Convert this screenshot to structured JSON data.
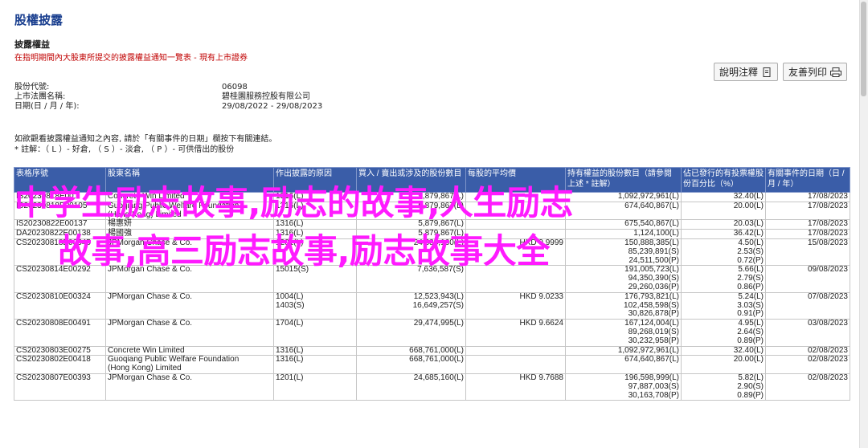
{
  "page": {
    "title": "股權披露"
  },
  "section": {
    "title": "披露權益",
    "subtitle": "在指明期間內大股東所提交的披露權益通知一覽表 - 現有上市證券"
  },
  "toolbar": {
    "explain_label": "說明注釋",
    "print_label": "友善列印"
  },
  "info": {
    "stock_code_label": "股份代號:",
    "stock_code": "06098",
    "company_label": "上市法團名稱:",
    "company": "碧桂園服務控股有限公司",
    "date_label": "日期(日 / 月 / 年):",
    "date_range": "29/08/2022 - 29/08/2023"
  },
  "note": {
    "line1": "如欲觀看披露權益通知之內容, 請於「有關事件的日期」欄按下有關連結。",
    "line2": "* 註解：（ L ）- 好倉, （ S ）- 淡倉, （ P ）- 可供借出的股份"
  },
  "table": {
    "headers": [
      "表格序號",
      "股東名稱",
      "作出披露的原因",
      "買入 / 賣出或涉及的股份數目",
      "每股的平均價",
      "持有權益的股份數目（請參閱上述 * 註解）",
      "佔已發行的有投票權股份百分比（%）",
      "有關事件的日期（日 / 月 / 年）"
    ],
    "rows": [
      {
        "form": "IS20230818E00...",
        "name": "Concrete Win Limited",
        "reason": "1316(L)",
        "shares": "5,879,867(L)",
        "price": "",
        "holding": "1,092,972,961(L)",
        "pct": "32.40(L)",
        "date": "17/08/2023"
      },
      {
        "form": "IS20230818E00105",
        "name": "Guoqiang Public Welfare Foundation\n(Hong Kong) Limited",
        "reason": "1316(L)",
        "shares": "5,879,867(L)",
        "price": "",
        "holding": "674,640,867(L)",
        "pct": "20.00(L)",
        "date": "17/08/2023"
      },
      {
        "form": "IS20230822E00137",
        "name": "楊惠妍",
        "reason": "1316(L)",
        "shares": "5,879,867(L)",
        "price": "",
        "holding": "675,540,867(L)",
        "pct": "20.03(L)",
        "date": "17/08/2023"
      },
      {
        "form": "DA20230822E00138",
        "name": "楊國強",
        "reason": "1316(L)",
        "shares": "5,879,867(L)",
        "price": "",
        "holding": "1,124,100(L)",
        "pct": "36.42(L)",
        "date": "17/08/2023"
      },
      {
        "form": "CS20230818E00545",
        "name": "JPMorgan Chase & Co.",
        "reason": "1201(L)",
        "shares": "24,685,160(L)",
        "price": "HKD 9.9999",
        "holding": "150,888,385(L)\n85,239,891(S)\n24,511,500(P)",
        "pct": "4.50(L)\n2.53(S)\n0.72(P)",
        "date": "15/08/2023"
      },
      {
        "form": "CS20230814E00292",
        "name": "JPMorgan Chase & Co.",
        "reason": "15015(S)",
        "shares": "7,636,587(S)",
        "price": "",
        "holding": "191,005,723(L)\n94,350,390(S)\n29,260,036(P)",
        "pct": "5.66(L)\n2.79(S)\n0.86(P)",
        "date": "09/08/2023"
      },
      {
        "form": "CS20230810E00324",
        "name": "JPMorgan Chase & Co.",
        "reason": "1004(L)\n1403(S)",
        "shares": "12,523,943(L)\n16,649,257(S)",
        "price": "HKD 9.0233",
        "holding": "176,793,821(L)\n102,458,598(S)\n30,826,878(P)",
        "pct": "5.24(L)\n3.03(S)\n0.91(P)",
        "date": "07/08/2023"
      },
      {
        "form": "CS20230808E00491",
        "name": "JPMorgan Chase & Co.",
        "reason": "1704(L)",
        "shares": "29,474,995(L)",
        "price": "HKD 9.6624",
        "holding": "167,124,004(L)\n89,268,019(S)\n30,232,958(P)",
        "pct": "4.95(L)\n2.64(S)\n0.89(P)",
        "date": "03/08/2023"
      },
      {
        "form": "CS20230803E00275",
        "name": "Concrete Win Limited",
        "reason": "1316(L)",
        "shares": "668,761,000(L)",
        "price": "",
        "holding": "1,092,972,961(L)",
        "pct": "32.40(L)",
        "date": "02/08/2023"
      },
      {
        "form": "CS20230802E00418",
        "name": "Guoqiang Public Welfare Foundation\n(Hong Kong) Limited",
        "reason": "1316(L)",
        "shares": "668,761,000(L)",
        "price": "",
        "holding": "674,640,867(L)",
        "pct": "20.00(L)",
        "date": "02/08/2023"
      },
      {
        "form": "CS20230807E00393",
        "name": "JPMorgan Chase & Co.",
        "reason": "1201(L)",
        "shares": "24,685,160(L)",
        "price": "HKD 9.7688",
        "holding": "196,598,999(L)\n97,887,003(S)\n30,163,708(P)",
        "pct": "5.82(L)\n2.90(S)\n0.89(P)",
        "date": "02/08/2023"
      }
    ]
  },
  "overlay": {
    "line1": "中学生励志故事,励志的故事,人生励志",
    "line2": "故事,高三励志故事,励志故事大全"
  },
  "colors": {
    "header_bg": "#3a5da8",
    "overlay": "#ff1aff",
    "subtitle": "#c00000",
    "title": "#1a3f8f"
  }
}
